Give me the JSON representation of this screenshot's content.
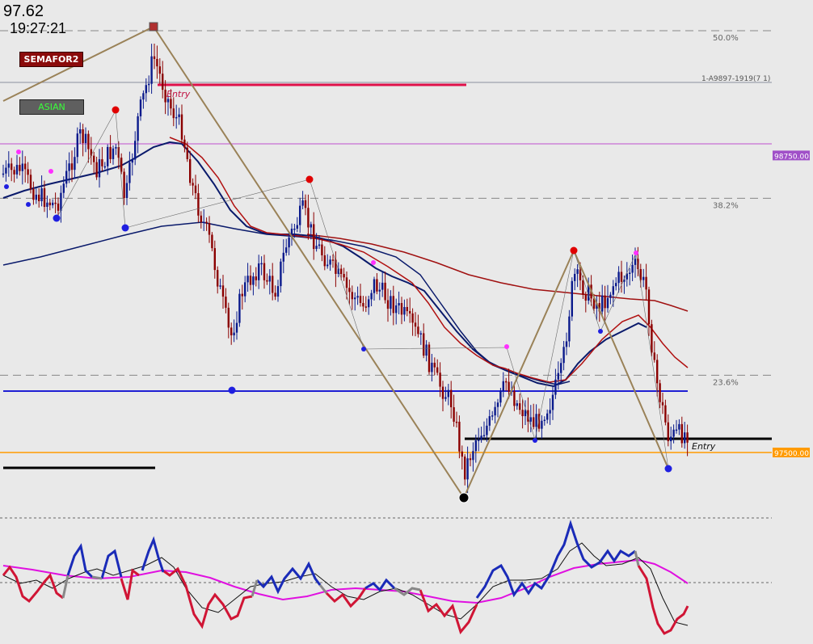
{
  "header": {
    "price": "97.62",
    "clock": "19:27:21"
  },
  "buttons": {
    "semafor": "SEMAFOR2",
    "asian": "ASIAN"
  },
  "fib_levels": [
    {
      "label": "50.0%",
      "price": 99275
    },
    {
      "label": "38.2%",
      "price": 98570
    },
    {
      "label": "23.6%",
      "price": 97825
    }
  ],
  "labels": {
    "overlay_text": "1-A9897-1919(7 1)",
    "entry": "Entry"
  },
  "price_tags": [
    {
      "text": "98750.00",
      "price": 98750,
      "color": "#a050c8"
    },
    {
      "text": "97500.00",
      "price": 97500,
      "color": "#ff9a00"
    }
  ],
  "colors": {
    "background": "#e9e9e9",
    "bull_candle": "#0a1a8c",
    "bear_candle": "#8b0000",
    "ma_fast": "#0a1a6b",
    "ma_slow": "#b01010",
    "zigzag": "#9a8258",
    "fib_line": "#888888",
    "blue_level": "#1f1fd4",
    "orange_level": "#ff9a00",
    "magenta_level": "#c050d0",
    "osc_bull": "#1a2bb8",
    "osc_bear": "#d01535",
    "osc_signal": "#e010e0",
    "osc_base": "#111111"
  },
  "chart_data": [
    {
      "type": "candlestick",
      "title": "",
      "y_scale_ref": [
        {
          "price": 99275,
          "pixel_note": "50.0% level"
        },
        {
          "price": 97500,
          "pixel_note": "orange level"
        }
      ],
      "ylim": [
        96900,
        99400
      ],
      "series": [
        {
          "name": "",
          "kind": "zigzag",
          "points_price": [
            98900,
            99310,
            96980,
            98310,
            97260
          ]
        },
        {
          "name": "",
          "kind": "level",
          "value": 98750
        },
        {
          "name": "",
          "kind": "level",
          "value": 97500
        }
      ],
      "semafor_markers": [
        {
          "type": "high",
          "price": 99310
        },
        {
          "type": "low",
          "price": 96980
        },
        {
          "type": "high",
          "price": 98320
        },
        {
          "type": "low",
          "price": 97260
        }
      ]
    },
    {
      "type": "line",
      "title": "",
      "series": [
        {
          "name": "",
          "kind": "oscillator"
        },
        {
          "name": "",
          "kind": "signal"
        }
      ]
    }
  ]
}
